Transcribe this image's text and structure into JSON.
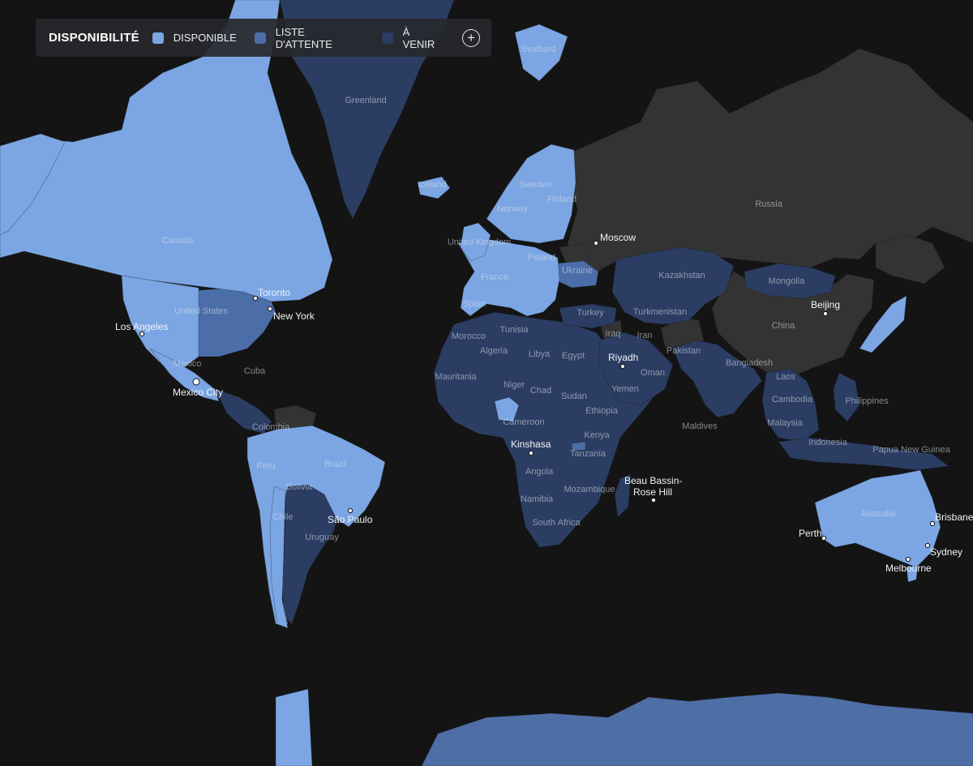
{
  "legend": {
    "title": "DISPONIBILITÉ",
    "items": [
      {
        "label": "DISPONIBLE",
        "color": "#7ba6e3"
      },
      {
        "label": "LISTE D'ATTENTE",
        "color": "#4b6ea8"
      },
      {
        "label": "À VENIR",
        "color": "#2b3d62"
      }
    ],
    "expand_icon": "plus-circle-icon",
    "expand_label": "+"
  },
  "colors": {
    "ocean": "#141414",
    "unavailable": "#343334",
    "available": "#7ba6e3",
    "waitlist": "#4b6ea8",
    "coming_soon": "#2b3d62",
    "antarctica": "#4e6ea6"
  },
  "countries": [
    "Greenland",
    "Svalbard",
    "Iceland",
    "Sweden",
    "Finland",
    "Norway",
    "Russia",
    "Moscow",
    "United Kingdom",
    "Poland",
    "Ukraine",
    "Canada",
    "France",
    "Kazakhstan",
    "Mongolia",
    "Spain",
    "Turkey",
    "Turkmenistan",
    "United States",
    "Beijing",
    "Morocco",
    "Tunisia",
    "Iraq",
    "Iran",
    "China",
    "Algeria",
    "Libya",
    "Egypt",
    "Pakistan",
    "Mexico",
    "Bangladesh",
    "Cuba",
    "Mauritania",
    "Niger",
    "Oman",
    "Laos",
    "Chad",
    "Sudan",
    "Yemen",
    "Philippines",
    "Cambodia",
    "Ethiopia",
    "Colombia",
    "Cameroon",
    "Maldives",
    "Malaysia",
    "Kenya",
    "Indonesia",
    "Papua New Guinea",
    "Tanzania",
    "Peru",
    "Brazil",
    "Angola",
    "Bolivia",
    "Mozambique",
    "Namibia",
    "Australia",
    "Chile",
    "South Africa",
    "Uruguay"
  ],
  "cities": [
    "Moscow",
    "Toronto",
    "Beijing",
    "New York",
    "Los Angeles",
    "Riyadh",
    "Mexico City",
    "Kinshasa",
    "Beau Bassin-",
    "Rose Hill",
    "São Paulo",
    "Brisbane",
    "Perth",
    "Sydney",
    "Melbourne"
  ]
}
